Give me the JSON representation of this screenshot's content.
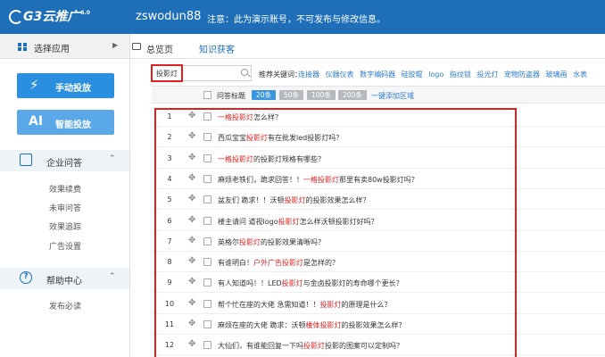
{
  "topbar": {
    "logo_text": "G3云推广",
    "logo_version": "6.0",
    "username": "zswodun88",
    "notice": "注意：此为演示账号，不可发布与修改信息。"
  },
  "sidebar": {
    "header_label": "选择应用",
    "btn_auto": "手动投放",
    "btn_ai_icon": "AI",
    "btn_ai": "智能投放",
    "sections": [
      {
        "label": "企业问答",
        "items": [
          "效果续费",
          "未审问答",
          "效果追踪",
          "广告设置"
        ]
      },
      {
        "label": "帮助中心",
        "items": [
          "发布必读"
        ]
      }
    ]
  },
  "tabs": {
    "overview": "总览页",
    "knowledge": "知识获客"
  },
  "search": {
    "value": "投影灯",
    "kw_label": "推荐关键词：",
    "keywords": [
      "连接器",
      "仪器仪表",
      "数字编码器",
      "硅胶辊",
      "logo",
      "指纹锁",
      "投光灯",
      "宠物防盗器",
      "玻璃画",
      "水表"
    ]
  },
  "table": {
    "col_title": "问答标题",
    "pills": [
      "20条",
      "50条",
      "100条",
      "200条"
    ],
    "add_link": "一键添加区域",
    "rows": [
      {
        "num": "1",
        "pre": "",
        "hl": "一格投影灯",
        "post": "怎么样？"
      },
      {
        "num": "2",
        "pre": "西瓜宝宝",
        "hl": "投影灯",
        "post": "有在批发led投影灯吗？"
      },
      {
        "num": "3",
        "pre": "",
        "hl": "一格投影灯",
        "post": "的投影灯规格有哪些？"
      },
      {
        "num": "4",
        "pre": "麻烦老铁们，跪求回答！！",
        "hl": "一格投影灯",
        "post": "那里有卖80w投影灯吗？"
      },
      {
        "num": "5",
        "pre": "盆友们 跪求！！沃顿",
        "hl": "投影灯",
        "post": "的投影效果怎么样？"
      },
      {
        "num": "6",
        "pre": "楼主请问 道视logo",
        "hl": "投影灯",
        "post": "怎么样沃顿投影灯好吗？"
      },
      {
        "num": "7",
        "pre": "英格尔",
        "hl": "投影灯",
        "post": "的投影效果清晰吗？"
      },
      {
        "num": "8",
        "pre": "有谁明白！",
        "hl": "户外广告投影灯",
        "post": "是怎样的？"
      },
      {
        "num": "9",
        "pre": "有人知道吗！！LED",
        "hl": "投影灯",
        "post": "与金卤投影灯的寿命哪个更长？"
      },
      {
        "num": "10",
        "pre": "帮个忙在座的大佬 急需知道！！",
        "hl": "投影灯",
        "post": "的原理是什么？"
      },
      {
        "num": "11",
        "pre": "麻烦在座的大佬 跪求：沃顿",
        "hl": "楼体投影灯",
        "post": "的投影效果怎么样？"
      },
      {
        "num": "12",
        "pre": "大仙们，有谁能回复一下吗",
        "hl": "投影灯",
        "post": "投影的图案可以定制吗？"
      }
    ]
  }
}
